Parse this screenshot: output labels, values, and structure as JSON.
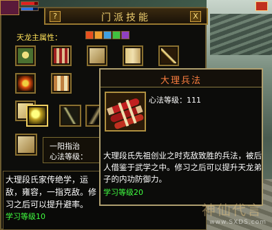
{
  "panel": {
    "title": "门派技能",
    "help_label": "?",
    "close_label": "X",
    "attr_label": "天龙主属性：",
    "elements": [
      {
        "name": "fire",
        "color": "#e85020"
      },
      {
        "name": "fire-2",
        "color": "#f0a030"
      },
      {
        "name": "water",
        "color": "#40a0e0"
      },
      {
        "name": "wood",
        "color": "#40c040"
      },
      {
        "name": "poison",
        "color": "#9040c0"
      }
    ]
  },
  "skill_row": {
    "name_a": "一阳指治",
    "name_b": "心法等级："
  },
  "description": {
    "text": "大理段氏家传绝学，运敌，雍容，一指克敌。修习之后可以提升避率。",
    "level": "学习等级10"
  },
  "tooltip": {
    "title": "大理兵法",
    "level_text": "心法等级：111",
    "desc": "大理段氏先祖创业之时克敌致胜的兵法，被后人借鉴于武学之中。修习之后可以提升天龙弟子的内功防御力。",
    "learn_level": "学习等级20"
  },
  "watermark": {
    "text": "www.SXDS.com",
    "logo": "神仙代言"
  }
}
